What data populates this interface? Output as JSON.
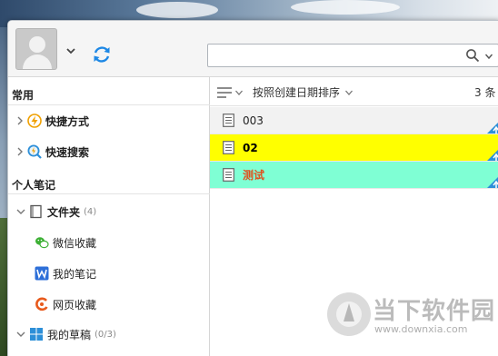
{
  "toolbar": {
    "search": {
      "value": "",
      "placeholder": ""
    }
  },
  "sidebar": {
    "section_common": "常用",
    "shortcuts": "快捷方式",
    "quick_search": "快速搜索",
    "section_personal": "个人笔记",
    "folder": {
      "label": "文件夹",
      "count": "(4)"
    },
    "items": [
      {
        "label": "微信收藏",
        "icon": "wechat-icon"
      },
      {
        "label": "我的笔记",
        "icon": "wiz-note-icon"
      },
      {
        "label": "网页收藏",
        "icon": "web-favorite-icon"
      }
    ],
    "drafts": {
      "label": "我的草稿",
      "count": "(0/3)"
    }
  },
  "list": {
    "sort_label": "按照创建日期排序",
    "count": "3 条",
    "notes": [
      {
        "title": "003",
        "bg": "#f2f2f2",
        "color": "#222222",
        "bold": false
      },
      {
        "title": "02",
        "bg": "#ffff00",
        "color": "#000000",
        "bold": true
      },
      {
        "title": "测试",
        "bg": "#7fffd4",
        "color": "#e0501e",
        "bold": true
      }
    ]
  },
  "colors": {
    "accent_blue": "#2d8fd8",
    "sync_blue": "#1e88e5"
  },
  "watermark": {
    "title": "当下软件园",
    "url": "www.downxia.com"
  }
}
